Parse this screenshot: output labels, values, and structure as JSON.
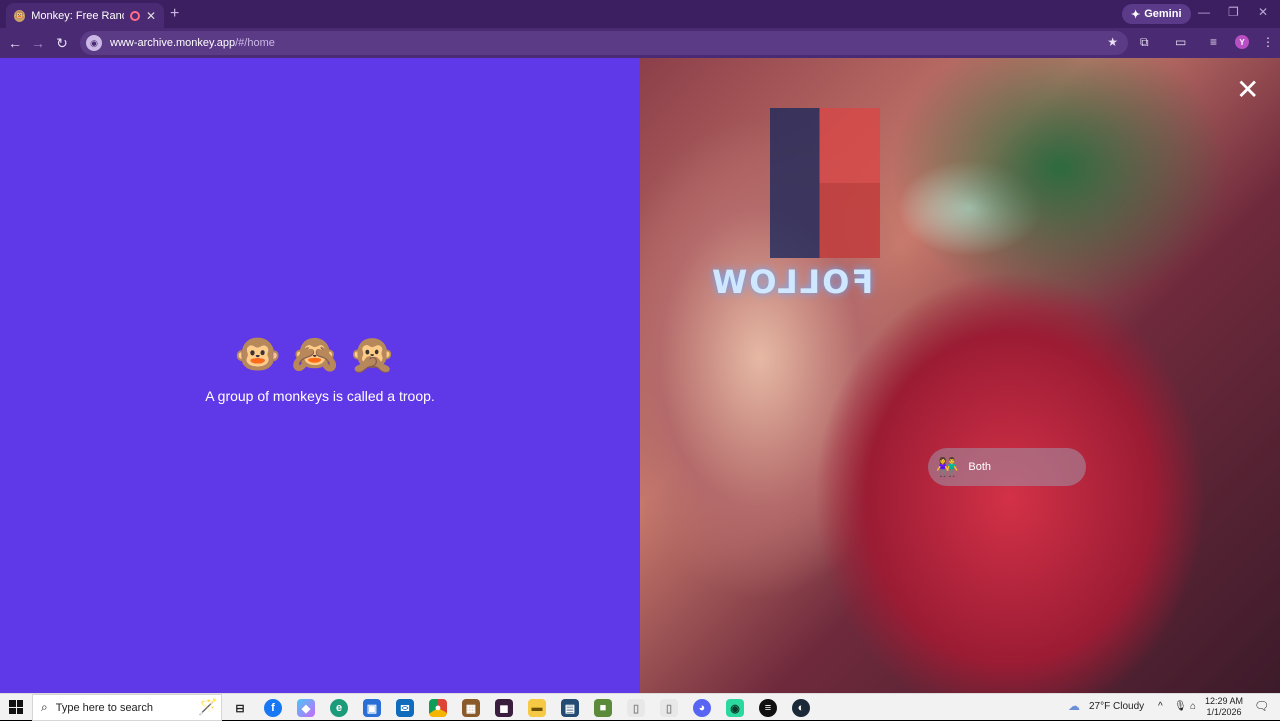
{
  "browser": {
    "tab_title": "Monkey: Free Random Vide",
    "tab_favicon": "🐵",
    "tab_close": "✕",
    "new_tab": "+",
    "gemini_label": "Gemini",
    "window_controls": {
      "minimize": "—",
      "maximize": "❐",
      "close": "✕"
    },
    "back": "←",
    "forward": "→",
    "reload": "↻",
    "url_host": "www-archive.monkey.app",
    "url_path": "/#/home",
    "star": "★",
    "profile_initial": "Y",
    "accent_color": "#4a2a72"
  },
  "home": {
    "emojis": "🐵🙈🙊",
    "fact_text": "A group of monkeys is called a troop.",
    "background_color": "#5f38e8"
  },
  "video": {
    "close_label": "✕",
    "neon_sign_text": "FOLLOW",
    "gender_filter": {
      "icon": "👫",
      "label": "Both"
    }
  },
  "taskbar": {
    "search_placeholder": "Type here to search",
    "weather_temp": "27°F",
    "weather_condition": "Cloudy",
    "time": "12:29 AM",
    "date": "1/1/2026"
  }
}
